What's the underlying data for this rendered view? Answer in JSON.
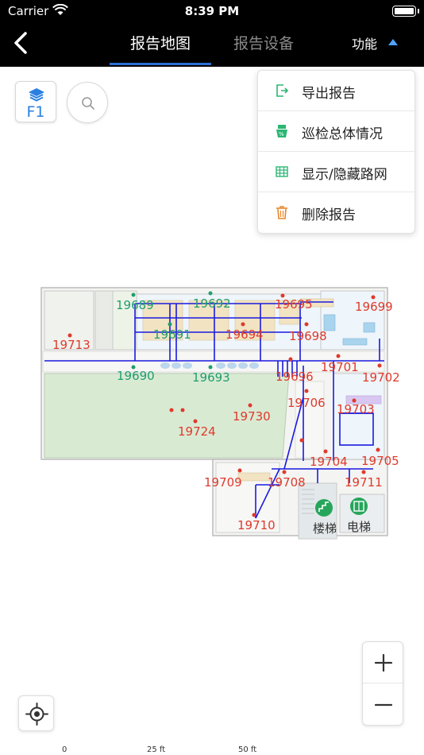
{
  "status_bar": {
    "carrier": "Carrier",
    "time": "8:39 PM"
  },
  "nav": {
    "tabs": [
      {
        "label": "报告地图",
        "active": true
      },
      {
        "label": "报告设备",
        "active": false
      }
    ],
    "function_label": "功能"
  },
  "floor": {
    "label": "F1"
  },
  "menu": {
    "items": [
      {
        "label": "导出报告",
        "icon": "export-icon"
      },
      {
        "label": "巡检总体情况",
        "icon": "inspection-icon"
      },
      {
        "label": "显示/隐藏路网",
        "icon": "grid-icon"
      },
      {
        "label": "删除报告",
        "icon": "trash-icon"
      }
    ]
  },
  "map": {
    "devices_green": [
      "19689",
      "19692",
      "19691",
      "19690",
      "19693"
    ],
    "devices_red": [
      "19695",
      "19699",
      "19713",
      "19694",
      "19698",
      "19696",
      "19701",
      "19702",
      "19706",
      "19703",
      "19730",
      "19724",
      "19704",
      "19705",
      "19709",
      "19708",
      "19711",
      "19710"
    ],
    "poi": {
      "stairs": "楼梯",
      "elevator": "电梯"
    }
  },
  "scale": {
    "ticks": [
      "0",
      "25 ft",
      "50 ft"
    ]
  },
  "colors": {
    "accent": "#2a6fd6",
    "device_ok": "#1f9e6e",
    "device_alert": "#e0392b",
    "route": "#1a1ae0"
  }
}
